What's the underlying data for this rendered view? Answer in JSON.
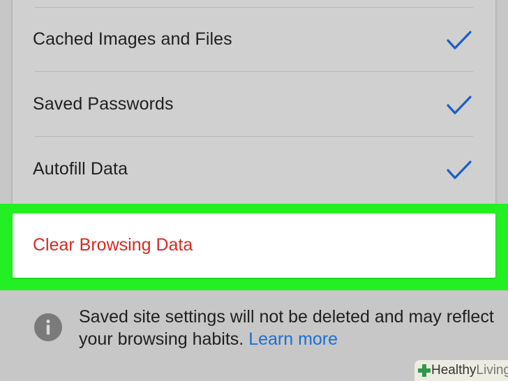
{
  "settings_list": {
    "items": [
      {
        "label": "Cached Images and Files",
        "checked": true
      },
      {
        "label": "Saved Passwords",
        "checked": true
      },
      {
        "label": "Autofill Data",
        "checked": true
      }
    ]
  },
  "clear_button": {
    "label": "Clear Browsing Data"
  },
  "info_note": {
    "text": "Saved site settings will not be deleted and may reflect your browsing habits.",
    "link_label": "Learn more"
  },
  "watermark": {
    "bold": "Healthy",
    "light": "Living"
  },
  "colors": {
    "checkmark": "#1b5fc4",
    "clear_label": "#d42c22",
    "link": "#1b6fd6",
    "highlight": "#23f023"
  }
}
